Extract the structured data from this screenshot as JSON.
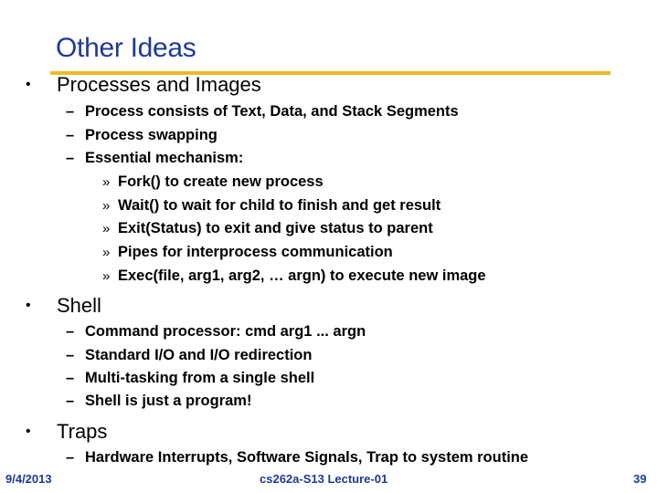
{
  "slide": {
    "title": "Other Ideas",
    "accent_color": "#f0b928",
    "title_color": "#1f3a93",
    "sections": [
      {
        "bullet": "•",
        "label": "Processes and Images",
        "items": [
          {
            "bullet": "–",
            "text": "Process consists of Text, Data, and Stack Segments"
          },
          {
            "bullet": "–",
            "text": "Process swapping"
          },
          {
            "bullet": "–",
            "text": "Essential mechanism:",
            "subitems": [
              {
                "bullet": "»",
                "text": "Fork() to create new process"
              },
              {
                "bullet": "»",
                "text": "Wait() to wait for child to finish and get result"
              },
              {
                "bullet": "»",
                "text": "Exit(Status) to exit and give status to parent"
              },
              {
                "bullet": "»",
                "text": "Pipes for interprocess communication"
              },
              {
                "bullet": "»",
                "text": "Exec(file, arg1, arg2, … argn) to execute new image"
              }
            ]
          }
        ]
      },
      {
        "bullet": "•",
        "label": "Shell",
        "items": [
          {
            "bullet": "–",
            "text": "Command processor: cmd arg1 ... argn"
          },
          {
            "bullet": "–",
            "text": "Standard I/O and I/O redirection"
          },
          {
            "bullet": "–",
            "text": "Multi-tasking from a single shell"
          },
          {
            "bullet": "–",
            "text": "Shell is just a program!"
          }
        ]
      },
      {
        "bullet": "•",
        "label": "Traps",
        "items": [
          {
            "bullet": "–",
            "text": "Hardware Interrupts, Software Signals, Trap to system routine"
          }
        ]
      }
    ]
  },
  "footer": {
    "date": "9/4/2013",
    "course": "cs262a-S13 Lecture-01",
    "page_number": "39"
  }
}
